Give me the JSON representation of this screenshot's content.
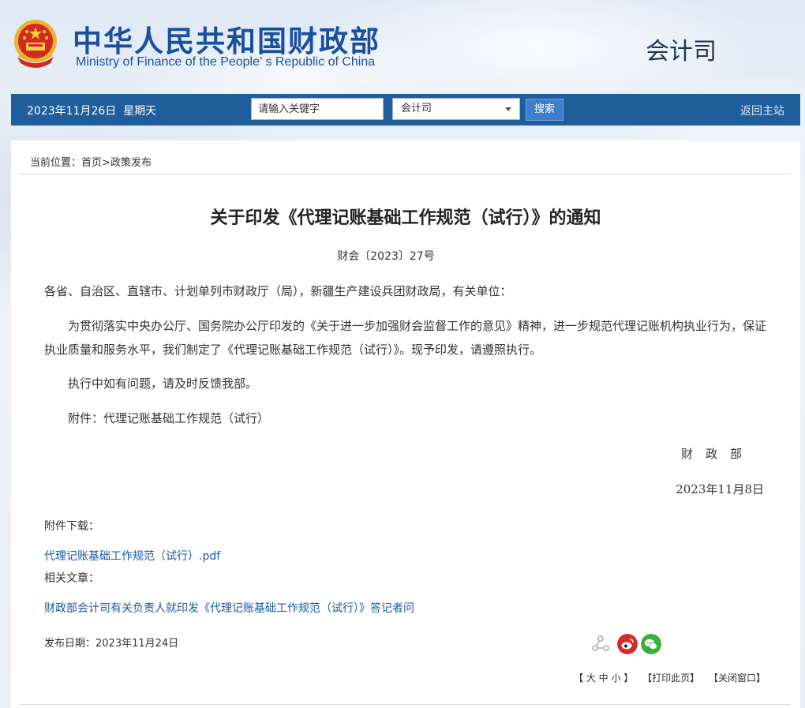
{
  "header": {
    "site_name_cn": "中华人民共和国财政部",
    "site_name_en": "Ministry of Finance of the People’ s Republic of China",
    "department": "会计司"
  },
  "navbar": {
    "date": "2023年11月26日",
    "weekday": "星期天",
    "search_placeholder": "请输入关键字",
    "dept_select_value": "会计司",
    "search_button": "搜索",
    "home_link": "返回主站"
  },
  "breadcrumb": {
    "prefix": "当前位置：",
    "home": "首页",
    "separator": ">",
    "current": "政策发布"
  },
  "article": {
    "title": "关于印发《代理记账基础工作规范（试行）》的通知",
    "doc_number": "财会〔2023〕27号",
    "salutation": "各省、自治区、直辖市、计划单列市财政厅（局），新疆生产建设兵团财政局，有关单位：",
    "paragraph1": "为贯彻落实中央办公厅、国务院办公厅印发的《关于进一步加强财会监督工作的意见》精神，进一步规范代理记账机构执业行为，保证执业质量和服务水平，我们制定了《代理记账基础工作规范（试行）》。现予印发，请遵照执行。",
    "paragraph2": "执行中如有问题，请及时反馈我部。",
    "attachment_note": "附件：代理记账基础工作规范（试行）",
    "signature": "财政部",
    "sign_date": "2023年11月8日"
  },
  "attachments": {
    "label": "附件下载：",
    "items": [
      "代理记账基础工作规范（试行）.pdf"
    ]
  },
  "related": {
    "label": "相关文章：",
    "items": [
      "财政部会计司有关负责人就印发《代理记账基础工作规范（试行）》答记者问"
    ]
  },
  "publish": {
    "label": "发布日期：",
    "date": "2023年11月24日"
  },
  "share": {
    "icons": [
      "share-icon",
      "weibo-icon",
      "wechat-icon"
    ],
    "weibo_color": "#d52b2b",
    "wechat_color": "#3bb13b"
  },
  "footer": {
    "font_size": "【 大 中 小 】",
    "print": "【打印此页】",
    "close": "【关闭窗口】"
  },
  "colors": {
    "brand_blue": "#1a4f9c",
    "nav_blue": "#1f5d9b",
    "link_blue": "#1a5aa6"
  }
}
